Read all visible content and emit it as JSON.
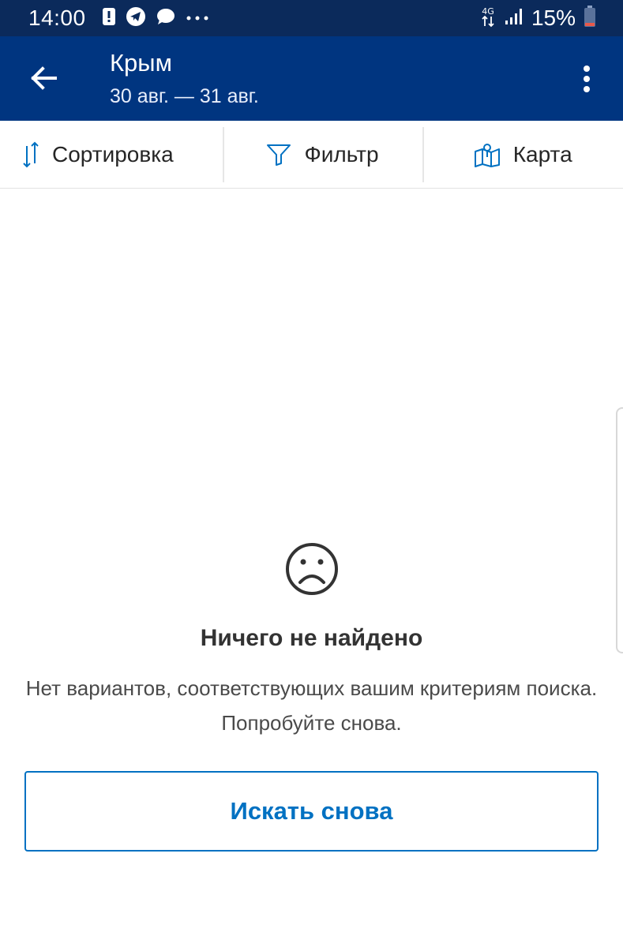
{
  "status_bar": {
    "time": "14:00",
    "battery": "15%",
    "network": "4G",
    "icons": [
      "alert-icon",
      "telegram-icon",
      "message-icon",
      "more-dots-icon",
      "signal-icon",
      "battery-icon"
    ]
  },
  "app_bar": {
    "title": "Крым",
    "dates": "30 авг. — 31 авг.",
    "back_icon": "arrow-left-icon",
    "menu_icon": "more-vertical-icon"
  },
  "toolbar": {
    "sort_label": "Сортировка",
    "filter_label": "Фильтр",
    "map_label": "Карта"
  },
  "empty_state": {
    "icon": "sad-face-icon",
    "title": "Ничего не найдено",
    "message": "Нет вариантов, соответствующих вашим критериям поиска. Попробуйте снова.",
    "button_label": "Искать снова"
  },
  "colors": {
    "status_bar_bg": "#0b2a5b",
    "app_bar_bg": "#003580",
    "accent": "#0071c2",
    "text": "#262626"
  }
}
